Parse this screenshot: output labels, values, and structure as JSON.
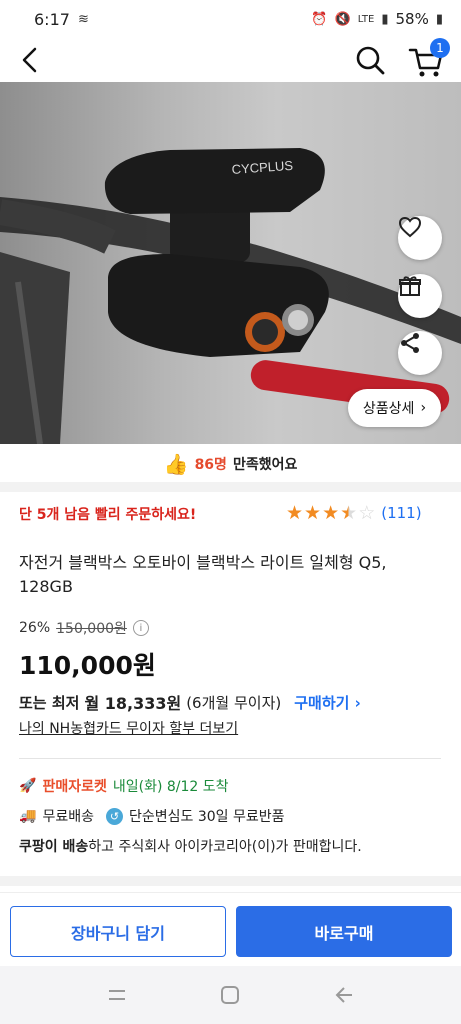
{
  "status_bar": {
    "time": "6:17",
    "battery": "58%",
    "network": "LTE"
  },
  "header": {
    "cart_count": "1"
  },
  "hero": {
    "brand_text": "CYCPLUS",
    "detail_button": "상품상세"
  },
  "satisfaction": {
    "count": "86명",
    "text": "만족했어요"
  },
  "product": {
    "stock_warning": "단 5개 남음 빨리 주문하세요!",
    "rating": 3.5,
    "review_count": "(111)",
    "title": "자전거 블랙박스 오토바이 블랙박스 라이트 일체형 Q5, 128GB",
    "discount_rate": "26%",
    "original_price": "150,000원",
    "price": "110,000원"
  },
  "installment": {
    "prefix": "또는 최저",
    "monthly": "월 18,333원",
    "months": "(6개월 무이자)",
    "buy_link": "구매하기",
    "card_link": "나의 NH농협카드 무이자 할부 더보기"
  },
  "delivery": {
    "rocket_label": "판매자로켓",
    "arrival": "내일(화) 8/12 도착",
    "free_shipping": "무료배송",
    "free_return": "단순변심도 30일 무료반품",
    "seller_bold": "쿠팡이 배송",
    "seller_rest": "하고 주식회사 아이카코리아(이)가 판매합니다."
  },
  "actions": {
    "add_to_cart": "장바구니 담기",
    "buy_now": "바로구매"
  },
  "colors": {
    "accent": "#2b6de6",
    "warning": "#d9241c",
    "star": "#f28b22",
    "arrival": "#1a8a3a"
  }
}
